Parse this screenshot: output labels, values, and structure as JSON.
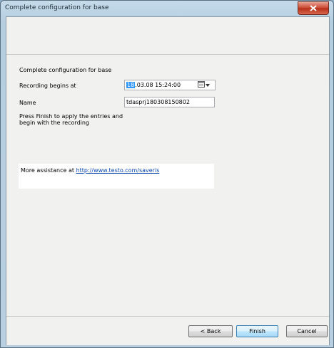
{
  "window": {
    "title": "Complete configuration for base"
  },
  "form": {
    "heading": "Complete configuration for base",
    "recording_label": "Recording begins at",
    "recording_value_day": "18",
    "recording_value_rest": ".03.08  15:24:00",
    "name_label": "Name",
    "name_value": "tdasprj180308150802",
    "instruction": "Press Finish to apply the entries and begin with the recording"
  },
  "assistance": {
    "prefix": "More assistance at ",
    "link": "http://www.testo.com/saveris"
  },
  "buttons": {
    "back": "< Back",
    "finish": "Finish",
    "cancel": "Cancel"
  },
  "icons": {
    "close": "close-icon",
    "calendar": "calendar-icon",
    "dropdown": "chevron-down-icon"
  },
  "colors": {
    "close_button": "#c9452f",
    "link": "#0645ad",
    "selection": "#3399ff"
  }
}
